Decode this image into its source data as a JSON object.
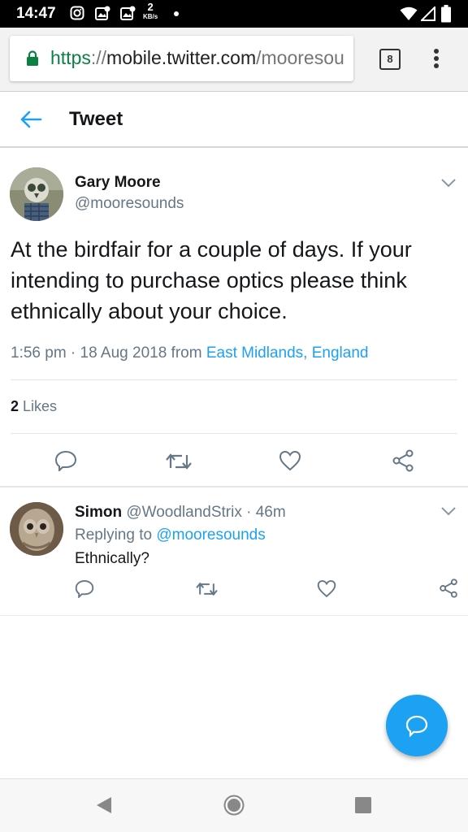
{
  "status_bar": {
    "time": "14:47",
    "net_speed_value": "2",
    "net_speed_unit": "KB/s",
    "icons": [
      "instagram-icon",
      "gallery-icon",
      "gallery-icon",
      "dot-icon",
      "wifi-icon",
      "signal-icon",
      "battery-icon"
    ]
  },
  "browser": {
    "url_scheme": "https",
    "url_sep": "://",
    "url_host": "mobile.twitter.com",
    "url_path": "/mooresou",
    "tab_count": "8",
    "colors": {
      "secure": "#0b8043"
    }
  },
  "header": {
    "title": "Tweet",
    "accent": "#1da1f2"
  },
  "tweet": {
    "author_name": "Gary Moore",
    "author_handle": "@mooresounds",
    "text": "At the birdfair for a couple of days. If your intending to purchase optics please think ethnically about your choice.",
    "time": "1:56 pm",
    "date_sep": " · ",
    "date": "18 Aug 2018",
    "from_label": " from ",
    "location": "East Midlands, England",
    "likes_count": "2",
    "likes_label": " Likes"
  },
  "reply": {
    "author_name": "Simon",
    "author_handle": "@WoodlandStrix",
    "time_sep": " · ",
    "time": "46m",
    "replying_label": "Replying to ",
    "replying_to": "@mooresounds",
    "text": "Ethnically?"
  },
  "actions": [
    "reply-icon",
    "retweet-icon",
    "like-icon",
    "share-icon"
  ],
  "nav": [
    "back-nav-icon",
    "home-nav-icon",
    "recents-nav-icon"
  ]
}
